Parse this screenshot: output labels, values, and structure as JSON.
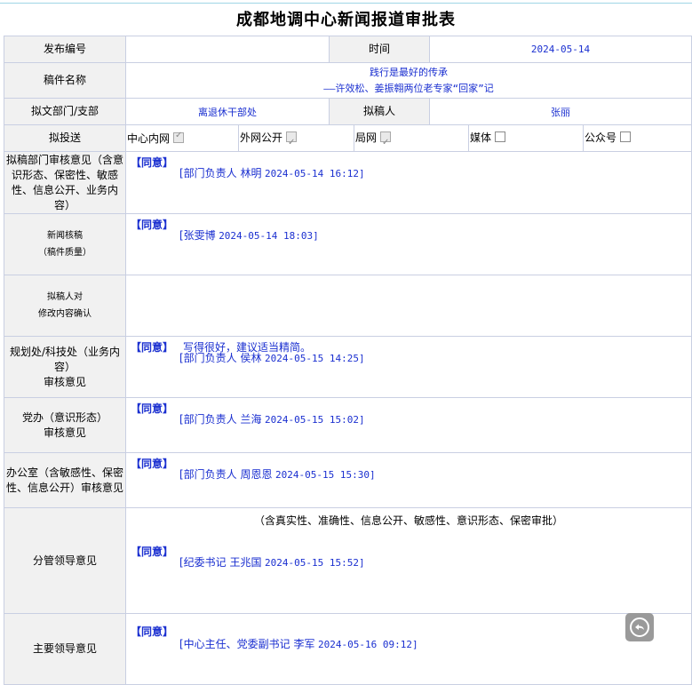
{
  "title": "成都地调中心新闻报道审批表",
  "row_publish": {
    "label": "发布编号",
    "value": "",
    "time_label": "时间",
    "time_value": "2024-05-14"
  },
  "row_manuscript": {
    "label": "稿件名称",
    "line1": "践行是最好的传承",
    "line2": "——许效松、姜振翱两位老专家“回家”记"
  },
  "row_dept": {
    "label": "拟文部门/支部",
    "dept_value": "离退休干部处",
    "drafter_label": "拟稿人",
    "drafter_value": "张丽"
  },
  "row_send": {
    "label": "拟投送",
    "options": [
      {
        "label": "中心内网",
        "checked": true
      },
      {
        "label": "外网公开",
        "checked": true
      },
      {
        "label": "局网",
        "checked": true
      },
      {
        "label": "媒体",
        "checked": false
      },
      {
        "label": "公众号",
        "checked": false
      }
    ]
  },
  "opinions": {
    "dept_review": {
      "label": "拟稿部门审核意见（含意识形态、保密性、敏感性、信息公开、业务内容）",
      "status": "【同意】",
      "signer": "[部门负责人 林明",
      "datetime": "2024-05-14 16:12]"
    },
    "news_check": {
      "label_line1": "新闻核稿",
      "label_line2": "（稿件质量）",
      "status": "【同意】",
      "signer": "[张雯博",
      "datetime": "2024-05-14 18:03]"
    },
    "drafter_confirm": {
      "label_line1": "拟稿人对",
      "label_line2": "修改内容确认"
    },
    "planning": {
      "label_line1": "规划处/科技处（业务内容）",
      "label_line2": "审核意见",
      "status": "【同意】",
      "comment": "写得很好，建议适当精简。",
      "signer": "[部门负责人 侯林",
      "datetime": "2024-05-15 14:25]"
    },
    "party_office": {
      "label_line1": "党办（意识形态）",
      "label_line2": "审核意见",
      "status": "【同意】",
      "signer": "[部门负责人 兰海",
      "datetime": "2024-05-15 15:02]"
    },
    "office": {
      "label": "办公室（含敏感性、保密性、信息公开）审核意见",
      "status": "【同意】",
      "signer": "[部门负责人 周恩恩",
      "datetime": "2024-05-15 15:30]"
    },
    "leader": {
      "label": "分管领导意见",
      "note": "（含真实性、准确性、信息公开、敏感性、意识形态、保密审批）",
      "status": "【同意】",
      "signer": "[纪委书记 王兆国",
      "datetime": "2024-05-15 15:52]"
    },
    "main_leader": {
      "label": "主要领导意见",
      "status": "【同意】",
      "signer": "[中心主任、党委副书记 李军",
      "datetime": "2024-05-16 09:12]"
    }
  },
  "colors": {
    "value_text": "#1a2fd0",
    "label_bg": "#f1f1f1",
    "border": "#c9cfe2"
  },
  "icons": {
    "floating_button": "reply-arrow-icon"
  }
}
